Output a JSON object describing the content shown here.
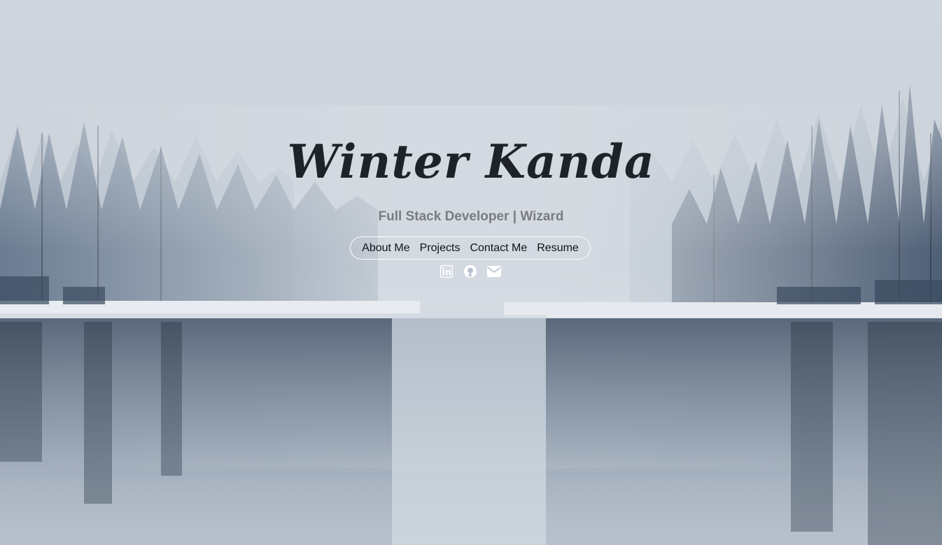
{
  "hero": {
    "title": "Winter Kanda",
    "subtitle": "Full Stack Developer | Wizard"
  },
  "nav": {
    "items": [
      {
        "label": "About Me"
      },
      {
        "label": "Projects"
      },
      {
        "label": "Contact Me"
      },
      {
        "label": "Resume"
      }
    ]
  },
  "socials": {
    "icons": [
      "linkedin-icon",
      "github-icon",
      "email-icon"
    ]
  },
  "colors": {
    "title": "#1e2327",
    "subtitle": "#7a7c7f",
    "nav_border": "#ffffff",
    "icon": "#ffffff"
  }
}
